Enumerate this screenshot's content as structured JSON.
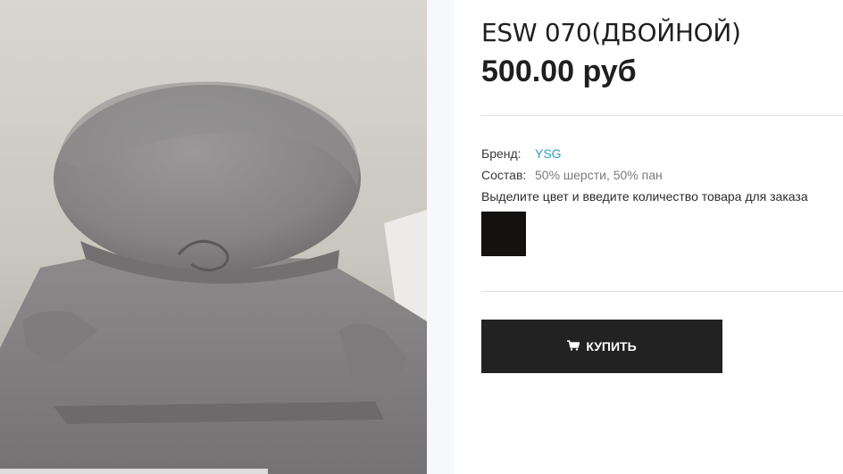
{
  "product": {
    "title": "ESW 070(ДВОЙНОЙ)",
    "price": "500.00 руб",
    "image_alt": "gray knitted beret and snood set"
  },
  "specs": {
    "brand_label": "Бренд:",
    "brand_value": "YSG",
    "composition_label": "Состав:",
    "composition_value": "50% шерсти, 50% пан"
  },
  "order": {
    "hint": "Выделите цвет и введите количество товара для заказа",
    "swatches": [
      {
        "color": "#141111"
      }
    ]
  },
  "buy_button": {
    "label": "КУПИТЬ",
    "icon": "cart-icon"
  },
  "colors": {
    "button_bg": "#222222",
    "link": "#3399cc",
    "product_gray": "#8a8a8a"
  }
}
